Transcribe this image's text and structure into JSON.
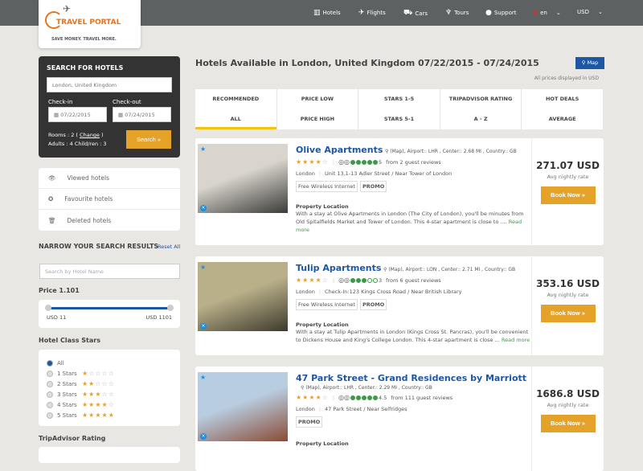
{
  "header": {
    "logo_text": "TRAVEL PORTAL",
    "logo_slogan": "SAVE MONEY. TRAVEL MORE.",
    "nav": [
      {
        "label": "Hotels",
        "icon": "building-icon"
      },
      {
        "label": "Flights",
        "icon": "plane-icon"
      },
      {
        "label": "Cars",
        "icon": "car-icon"
      },
      {
        "label": "Tours",
        "icon": "palm-icon"
      },
      {
        "label": "Support",
        "icon": "person-icon"
      }
    ],
    "language": "en",
    "currency": "USD"
  },
  "search": {
    "title": "SEARCH FOR HOTELS",
    "destination": "London, United Kingdom",
    "checkin_label": "Check-in",
    "checkin": "07/22/2015",
    "checkout_label": "Check-out",
    "checkout": "07/24/2015",
    "rooms_text": "Rooms : 2 (",
    "change": "Change",
    "rooms_close": ")",
    "guests": "Adults : 4 Child/ren : 3",
    "button": "Search »"
  },
  "lists": [
    {
      "label": "Viewed hotels",
      "icon": "eye-icon"
    },
    {
      "label": "Favourite hotels",
      "icon": "star-circle-icon"
    },
    {
      "label": "Deleted hotels",
      "icon": "trash-icon"
    }
  ],
  "filters": {
    "title": "NARROW YOUR SEARCH RESULTS",
    "reset": "Reset All",
    "name_placeholder": "Search by Hotel Name",
    "price_title": "Price 1.101",
    "price_min": "USD 11",
    "price_max": "USD 1101",
    "price_range_values": [
      11,
      1101
    ],
    "stars_title": "Hotel Class Stars",
    "star_options": [
      {
        "label": "All",
        "stars": 0,
        "selected": true
      },
      {
        "label": "1 Stars",
        "stars": 1
      },
      {
        "label": "2 Stars",
        "stars": 2
      },
      {
        "label": "3 Stars",
        "stars": 3
      },
      {
        "label": "4 Stars",
        "stars": 4
      },
      {
        "label": "5 Stars",
        "stars": 5
      }
    ],
    "tripadvisor_title": "TripAdvisor Rating"
  },
  "main": {
    "title": "Hotels Available in London, United Kingdom 07/22/2015 - 07/24/2015",
    "map_button": "Map",
    "price_note": "All prices displayed in USD",
    "sorts": [
      [
        "RECOMMENDED",
        "ALL"
      ],
      [
        "PRICE LOW",
        "PRICE HIGH"
      ],
      [
        "STARS 1-5",
        "STARS 5-1"
      ],
      [
        "TRIPADVISOR RATING",
        "A - Z"
      ],
      [
        "HOT DEALS",
        "AVERAGE"
      ]
    ],
    "active_sort": "ALL"
  },
  "hotels": [
    {
      "name": "Olive Apartments",
      "meta": "(Map), Airport:: LHR , Center:: 2.68 MI , Country:: GB",
      "stars": 4,
      "ta_score": "5",
      "ta_filled": 5,
      "reviews": "from 2 guest reviews",
      "city": "London",
      "address": "Unit 13,1-13 Adler Street / Near Tower of London",
      "tags": [
        "Free Wireless Internet",
        "PROMO"
      ],
      "loc_title": "Property Location",
      "desc": "With a stay at Olive Apartments in London (The City of London), you'll be minutes from Old Spitalfields Market and Tower of London. This 4-star apartment is close to ....",
      "read_more": "Read more",
      "price": "271.07 USD",
      "avg": "Avg nightly rate",
      "book": "Book Now »",
      "img_colors": [
        "#d9d5cc",
        "#3a3a38"
      ]
    },
    {
      "name": "Tulip Apartments",
      "meta": "(Map), Airport:: LON , Center:: 2.71 MI , Country:: GB",
      "stars": 4,
      "ta_score": "3",
      "ta_filled": 3,
      "reviews": "from 6 guest reviews",
      "city": "London",
      "address": "Check-In:123 Kings Cross Road / Near British Library",
      "tags": [
        "Free Wireless Internet",
        "PROMO"
      ],
      "loc_title": "Property Location",
      "desc": "With a stay at Tulip Apartments in London (Kings Cross St. Pancras), you'll be convenient to Dickens House and King's College London. This 4-star apartment is close ...",
      "read_more": "Read more",
      "price": "353.16 USD",
      "avg": "Avg nightly rate",
      "book": "Book Now »",
      "img_colors": [
        "#b9b08a",
        "#3d3a2c"
      ]
    },
    {
      "name": "47 Park Street - Grand Residences by Marriott",
      "meta": "(Map), Airport:: LHR , Center:: 2.29 MI , Country:: GB",
      "stars": 4,
      "ta_score": "4.5",
      "ta_filled": 5,
      "reviews": "from 111 guest reviews",
      "city": "London",
      "address": "47 Park Street / Near Selfridges",
      "tags": [
        "PROMO"
      ],
      "loc_title": "Property Location",
      "desc": "",
      "read_more": "",
      "price": "1686.8 USD",
      "avg": "Avg nightly rate",
      "book": "Book Now »",
      "img_colors": [
        "#b8cde0",
        "#8a4a36"
      ]
    }
  ]
}
